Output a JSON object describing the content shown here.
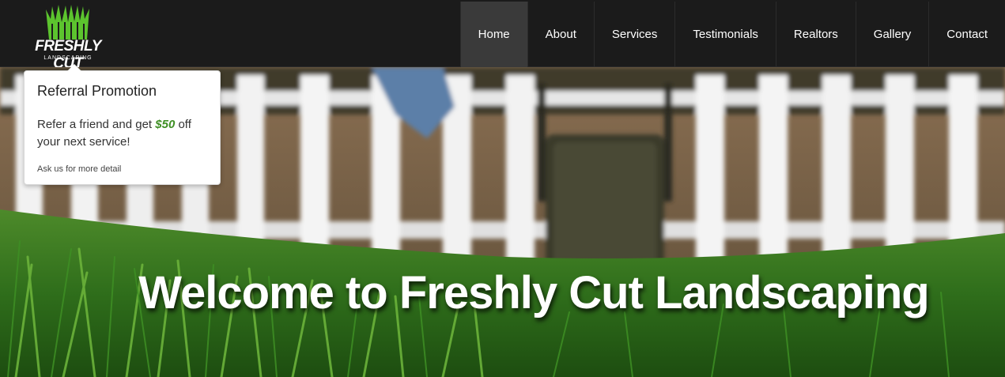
{
  "header": {
    "brand_name": "FRESHLY CUT",
    "brand_sub": "LANDSCAPING",
    "brand_color": "#5cc42e"
  },
  "nav": {
    "items": [
      {
        "label": "Home",
        "active": true
      },
      {
        "label": "About"
      },
      {
        "label": "Services"
      },
      {
        "label": "Testimonials"
      },
      {
        "label": "Realtors"
      },
      {
        "label": "Gallery"
      },
      {
        "label": "Contact"
      }
    ]
  },
  "popover": {
    "title": "Referral Promotion",
    "body_prefix": "Refer a friend and get ",
    "amount": "$50",
    "body_suffix": " off your next service!",
    "note": "Ask us for more detail"
  },
  "hero": {
    "title": "Welcome to Freshly Cut Landscaping"
  }
}
